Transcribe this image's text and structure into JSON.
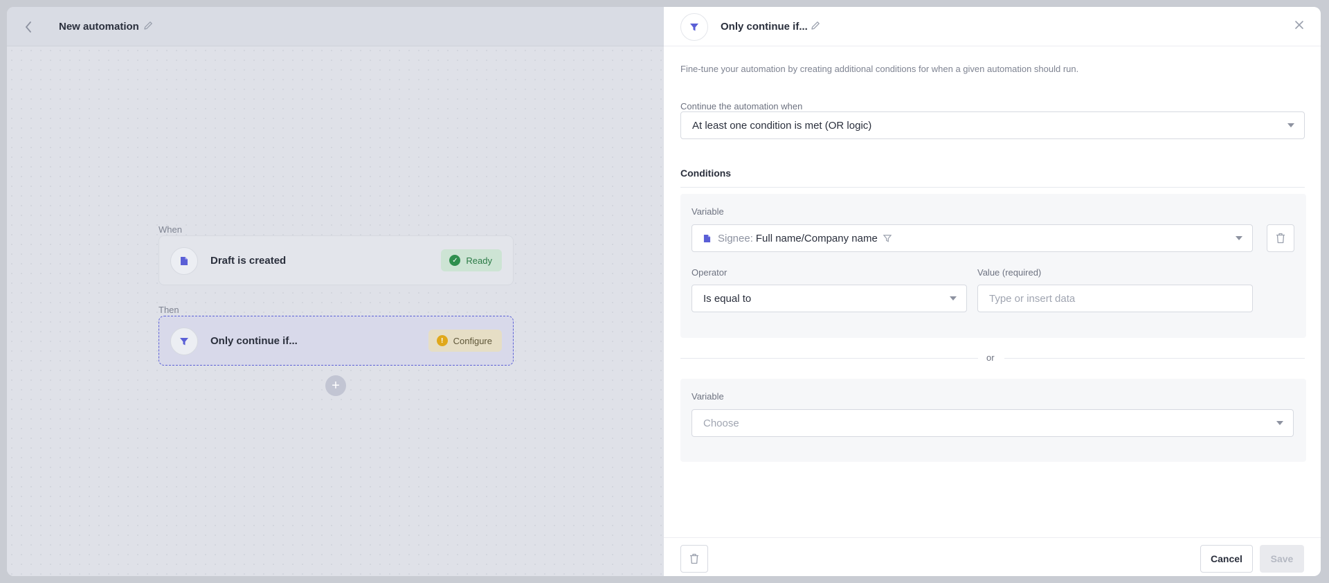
{
  "canvas": {
    "title": "New automation",
    "when_label": "When",
    "then_label": "Then",
    "steps": [
      {
        "name": "Draft is created",
        "badge": "Ready"
      },
      {
        "name": "Only continue if...",
        "badge": "Configure"
      }
    ],
    "add_symbol": "+"
  },
  "panel": {
    "title": "Only continue if...",
    "description": "Fine-tune your automation by creating additional conditions for when a given automation should run.",
    "continue_label": "Continue the automation when",
    "continue_value": "At least one condition is met (OR logic)",
    "conditions_title": "Conditions",
    "condition1": {
      "variable_label": "Variable",
      "variable_prefix": "Signee:",
      "variable_value": "Full name/Company name",
      "operator_label": "Operator",
      "operator_value": "Is equal to",
      "value_label": "Value (required)",
      "value_placeholder": "Type or insert data"
    },
    "or_label": "or",
    "condition2": {
      "variable_label": "Variable",
      "variable_placeholder": "Choose"
    },
    "cancel_label": "Cancel",
    "save_label": "Save"
  },
  "colors": {
    "accent": "#5a5fd6",
    "ready_green": "#2f8f4e",
    "configure_yellow": "#e0a81b"
  }
}
